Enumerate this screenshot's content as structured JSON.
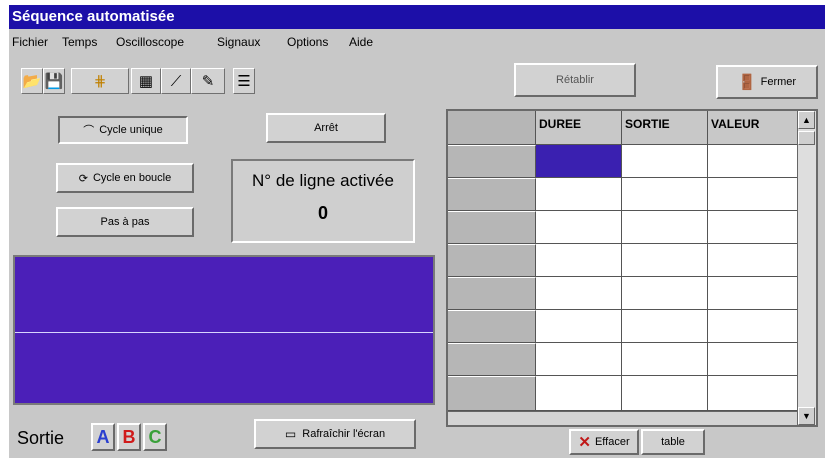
{
  "window": {
    "title": "Séquence automatisée"
  },
  "menu": [
    "Fichier",
    "Temps",
    "Oscilloscope",
    "Signaux",
    "Options",
    "Aide"
  ],
  "toolbar": {
    "icons": [
      "open-icon",
      "save-icon",
      "grid-icon",
      "pattern-icon",
      "curve-icon",
      "pen-icon",
      "list-icon"
    ]
  },
  "buttons": {
    "cycle_unique": "Cycle unique",
    "arret": "Arrêt",
    "cycle_boucle": "Cycle en boucle",
    "pas_a_pas": "Pas à pas",
    "retablir": "Rétablir",
    "fermer": "Fermer",
    "rafraichir": "Rafraîchir l'écran",
    "effacer": "Effacer",
    "table": "table"
  },
  "status": {
    "line_label": "N° de ligne activée",
    "line_value": "0"
  },
  "table": {
    "columns": [
      "DUREE",
      "SORTIE",
      "VALEUR"
    ],
    "selected_row": 0,
    "selected_col": 0
  },
  "sortie": {
    "label": "Sortie",
    "channels": [
      "A",
      "B",
      "C"
    ],
    "channel_colors": [
      "#2a3fd0",
      "#d01a1a",
      "#3aa03a"
    ]
  },
  "colors": {
    "title_bar": "#1c0fa8",
    "scope_bg": "#4b1fb8",
    "selection": "#3a20b0"
  }
}
